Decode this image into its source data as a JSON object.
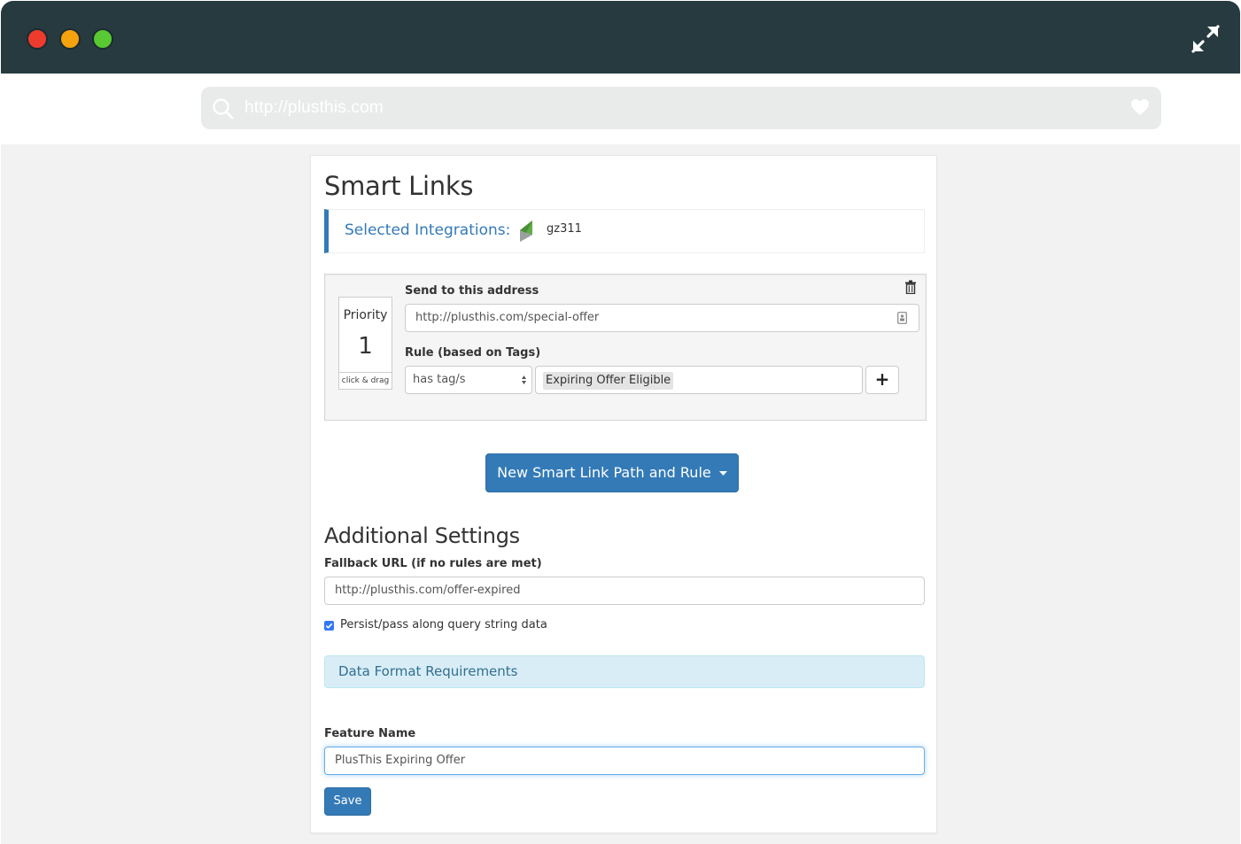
{
  "browser": {
    "url": "http://plusthis.com"
  },
  "page": {
    "title": "Smart Links"
  },
  "integrations": {
    "label": "Selected Integrations:",
    "app_name": "gz311"
  },
  "rule": {
    "send_label": "Send to this address",
    "send_value": "http://plusthis.com/special-offer",
    "priority_label": "Priority",
    "priority_value": "1",
    "drag_hint": "click & drag",
    "rule_label": "Rule (based on Tags)",
    "condition_value": "has tag/s",
    "tag_value": "Expiring Offer Eligible",
    "add_symbol": "+"
  },
  "new_rule_button": "New Smart Link Path and Rule",
  "additional": {
    "title": "Additional Settings",
    "fallback_label": "Fallback URL (if no rules are met)",
    "fallback_value": "http://plusthis.com/offer-expired",
    "persist_label": "Persist/pass along query string data",
    "persist_checked": true,
    "data_format": "Data Format Requirements"
  },
  "feature": {
    "label": "Feature Name",
    "value": "PlusThis Expiring Offer"
  },
  "save_button": "Save",
  "colors": {
    "titlebar": "#263a40",
    "primary": "#337ab7",
    "info_bg": "#d9edf7",
    "info_text": "#31708f"
  }
}
